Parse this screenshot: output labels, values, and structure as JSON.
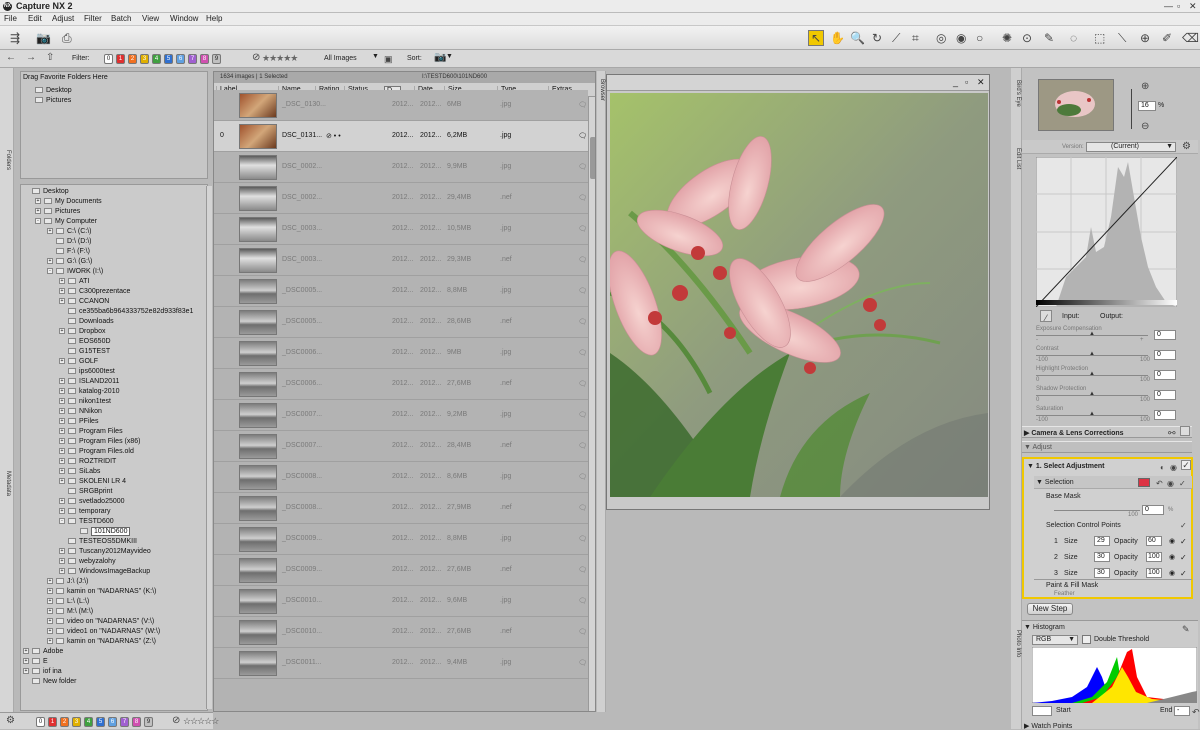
{
  "window": {
    "title": "Capture NX 2",
    "logo": "NX"
  },
  "menu": [
    "File",
    "Edit",
    "Adjust",
    "Filter",
    "Batch",
    "View",
    "Window",
    "Help"
  ],
  "toolbar2": {
    "filter_label": "Filter:",
    "filter_chips": [
      "0",
      "1",
      "2",
      "3",
      "4",
      "5",
      "6",
      "7",
      "8",
      "9"
    ],
    "filter_colors": [
      "#ffffff",
      "#e03030",
      "#f07020",
      "#e0b000",
      "#40a040",
      "#3070d0",
      "#60a0e0",
      "#a060d0",
      "#d050b0",
      "#c0c0c0"
    ],
    "show_dropdown": "All Images",
    "sort_label": "Sort:"
  },
  "sidebars": {
    "folders": "Folders",
    "metadata": "Metadata",
    "browser": "Browser",
    "birds_eye": "Bird's Eye",
    "edit_list": "Edit List",
    "photo_info": "Photo Info"
  },
  "favorites": {
    "header": "Drag Favorite Folders Here",
    "items": [
      "Desktop",
      "Pictures"
    ]
  },
  "tree": [
    {
      "label": "Desktop",
      "d": 0,
      "pm": "",
      "icon": true
    },
    {
      "label": "My Documents",
      "d": 1,
      "pm": "+",
      "icon": true
    },
    {
      "label": "Pictures",
      "d": 1,
      "pm": "+",
      "icon": true
    },
    {
      "label": "My Computer",
      "d": 1,
      "pm": "-",
      "icon": true
    },
    {
      "label": "C:\\ (C:\\)",
      "d": 2,
      "pm": "+",
      "icon": true
    },
    {
      "label": "D:\\ (D:\\)",
      "d": 2,
      "pm": "",
      "icon": true
    },
    {
      "label": "F:\\ (F:\\)",
      "d": 2,
      "pm": "",
      "icon": true
    },
    {
      "label": "G:\\ (G:\\)",
      "d": 2,
      "pm": "+",
      "icon": true
    },
    {
      "label": "IWORK (I:\\)",
      "d": 2,
      "pm": "-",
      "icon": true
    },
    {
      "label": "ATI",
      "d": 3,
      "pm": "+",
      "icon": true
    },
    {
      "label": "C300prezentace",
      "d": 3,
      "pm": "+",
      "icon": true
    },
    {
      "label": "CCANON",
      "d": 3,
      "pm": "+",
      "icon": true
    },
    {
      "label": "ce355ba6b964333752e82d933f83e1",
      "d": 3,
      "pm": "",
      "icon": true
    },
    {
      "label": "Downloads",
      "d": 3,
      "pm": "",
      "icon": true
    },
    {
      "label": "Dropbox",
      "d": 3,
      "pm": "+",
      "icon": true
    },
    {
      "label": "EOS650D",
      "d": 3,
      "pm": "",
      "icon": true
    },
    {
      "label": "G15TEST",
      "d": 3,
      "pm": "",
      "icon": true
    },
    {
      "label": "GOLF",
      "d": 3,
      "pm": "+",
      "icon": true
    },
    {
      "label": "ips6000test",
      "d": 3,
      "pm": "",
      "icon": true
    },
    {
      "label": "ISLAND2011",
      "d": 3,
      "pm": "+",
      "icon": true
    },
    {
      "label": "katalog-2010",
      "d": 3,
      "pm": "+",
      "icon": true
    },
    {
      "label": "nikon1test",
      "d": 3,
      "pm": "+",
      "icon": true
    },
    {
      "label": "NNikon",
      "d": 3,
      "pm": "+",
      "icon": true
    },
    {
      "label": "PFiles",
      "d": 3,
      "pm": "+",
      "icon": true
    },
    {
      "label": "Program Files",
      "d": 3,
      "pm": "+",
      "icon": true
    },
    {
      "label": "Program Files (x86)",
      "d": 3,
      "pm": "+",
      "icon": true
    },
    {
      "label": "Program Files.old",
      "d": 3,
      "pm": "+",
      "icon": true
    },
    {
      "label": "ROZTRIDIT",
      "d": 3,
      "pm": "+",
      "icon": true
    },
    {
      "label": "SiLabs",
      "d": 3,
      "pm": "+",
      "icon": true
    },
    {
      "label": "SKOLENI LR 4",
      "d": 3,
      "pm": "+",
      "icon": true
    },
    {
      "label": "SRGBprint",
      "d": 3,
      "pm": "",
      "icon": true
    },
    {
      "label": "svetlado25000",
      "d": 3,
      "pm": "+",
      "icon": true
    },
    {
      "label": "temporary",
      "d": 3,
      "pm": "+",
      "icon": true
    },
    {
      "label": "TESTD600",
      "d": 3,
      "pm": "-",
      "icon": true
    },
    {
      "label": "101ND600",
      "d": 4,
      "pm": "",
      "icon": true,
      "sel": true
    },
    {
      "label": "TESTEOS5DMKIII",
      "d": 3,
      "pm": "",
      "icon": true
    },
    {
      "label": "Tuscany2012Mayvideo",
      "d": 3,
      "pm": "+",
      "icon": true
    },
    {
      "label": "webyzalohy",
      "d": 3,
      "pm": "+",
      "icon": true
    },
    {
      "label": "WindowsImageBackup",
      "d": 3,
      "pm": "+",
      "icon": true
    },
    {
      "label": "J:\\ (J:\\)",
      "d": 2,
      "pm": "+",
      "icon": true
    },
    {
      "label": "kamin  on \"NADARNAS\" (K:\\)",
      "d": 2,
      "pm": "+",
      "icon": true
    },
    {
      "label": "L:\\ (L:\\)",
      "d": 2,
      "pm": "+",
      "icon": true
    },
    {
      "label": "M:\\ (M:\\)",
      "d": 2,
      "pm": "+",
      "icon": true
    },
    {
      "label": "video  on \"NADARNAS\" (V:\\)",
      "d": 2,
      "pm": "+",
      "icon": true
    },
    {
      "label": "video1  on \"NADARNAS\" (W:\\)",
      "d": 2,
      "pm": "+",
      "icon": true
    },
    {
      "label": "kamin  on \"NADARNAS\" (Z:\\)",
      "d": 2,
      "pm": "+",
      "icon": true
    },
    {
      "label": "Adobe",
      "d": 0,
      "pm": "+",
      "icon": true
    },
    {
      "label": "E",
      "d": 0,
      "pm": "+",
      "icon": true
    },
    {
      "label": "iof ina",
      "d": 0,
      "pm": "+",
      "icon": true
    },
    {
      "label": "New folder",
      "d": 0,
      "pm": "",
      "icon": true
    }
  ],
  "browser": {
    "status": "1634 images | 1 Selected",
    "path": "I:\\TESTD600\\101ND600",
    "columns": [
      "Label",
      "Name",
      "Rating",
      "Status",
      "D...",
      "Date...",
      "Size",
      "Type",
      "Extras"
    ],
    "rows": [
      {
        "label": "",
        "name": "_DSC_0130...",
        "date": "2012...",
        "date2": "2012...",
        "size": "6MB",
        "type": ".jpg",
        "kind": "warm"
      },
      {
        "label": "0",
        "name": "DSC_0131...",
        "date": "2012...",
        "date2": "2012...",
        "size": "6,2MB",
        "type": ".jpg",
        "kind": "warm",
        "sel": true
      },
      {
        "label": "",
        "name": "DSC_0002...",
        "date": "2012...",
        "date2": "2012...",
        "size": "9,9MB",
        "type": ".jpg",
        "kind": "gray"
      },
      {
        "label": "",
        "name": "DSC_0002...",
        "date": "2012...",
        "date2": "2012...",
        "size": "29,4MB",
        "type": ".nef",
        "kind": "gray"
      },
      {
        "label": "",
        "name": "DSC_0003...",
        "date": "2012...",
        "date2": "2012...",
        "size": "10,5MB",
        "type": ".jpg",
        "kind": "gray"
      },
      {
        "label": "",
        "name": "DSC_0003...",
        "date": "2012...",
        "date2": "2012...",
        "size": "29,3MB",
        "type": ".nef",
        "kind": "gray"
      },
      {
        "label": "",
        "name": "_DSC0005...",
        "date": "2012...",
        "date2": "2012...",
        "size": "8,8MB",
        "type": ".jpg",
        "kind": "land"
      },
      {
        "label": "",
        "name": "_DSC0005...",
        "date": "2012...",
        "date2": "2012...",
        "size": "28,6MB",
        "type": ".nef",
        "kind": "land"
      },
      {
        "label": "",
        "name": "_DSC0006...",
        "date": "2012...",
        "date2": "2012...",
        "size": "9MB",
        "type": ".jpg",
        "kind": "land"
      },
      {
        "label": "",
        "name": "_DSC0006...",
        "date": "2012...",
        "date2": "2012...",
        "size": "27,6MB",
        "type": ".nef",
        "kind": "land"
      },
      {
        "label": "",
        "name": "_DSC0007...",
        "date": "2012...",
        "date2": "2012...",
        "size": "9,2MB",
        "type": ".jpg",
        "kind": "land"
      },
      {
        "label": "",
        "name": "_DSC0007...",
        "date": "2012...",
        "date2": "2012...",
        "size": "28,4MB",
        "type": ".nef",
        "kind": "land"
      },
      {
        "label": "",
        "name": "_DSC0008...",
        "date": "2012...",
        "date2": "2012...",
        "size": "8,6MB",
        "type": ".jpg",
        "kind": "land"
      },
      {
        "label": "",
        "name": "_DSC0008...",
        "date": "2012...",
        "date2": "2012...",
        "size": "27,9MB",
        "type": ".nef",
        "kind": "land"
      },
      {
        "label": "",
        "name": "_DSC0009...",
        "date": "2012...",
        "date2": "2012...",
        "size": "8,8MB",
        "type": ".jpg",
        "kind": "land"
      },
      {
        "label": "",
        "name": "_DSC0009...",
        "date": "2012...",
        "date2": "2012...",
        "size": "27,6MB",
        "type": ".nef",
        "kind": "land"
      },
      {
        "label": "",
        "name": "_DSC0010...",
        "date": "2012...",
        "date2": "2012...",
        "size": "9,6MB",
        "type": ".jpg",
        "kind": "land"
      },
      {
        "label": "",
        "name": "_DSC0010...",
        "date": "2012...",
        "date2": "2012...",
        "size": "27,6MB",
        "type": ".nef",
        "kind": "land"
      },
      {
        "label": "",
        "name": "_DSC0011...",
        "date": "2012...",
        "date2": "2012...",
        "size": "9,4MB",
        "type": ".jpg",
        "kind": "land"
      }
    ]
  },
  "birdseye": {
    "zoom": "16",
    "unit": "%"
  },
  "editlist": {
    "version_label": "Version:",
    "version_value": "(Current)",
    "input_label": "Input:",
    "output_label": "Output:",
    "sliders": [
      {
        "label": "Exposure Compensation",
        "value": "0",
        "min": "-",
        "max": "+"
      },
      {
        "label": "Contrast",
        "value": "0",
        "min": "-100",
        "max": "100"
      },
      {
        "label": "Highlight Protection",
        "value": "0",
        "min": "0",
        "max": "100"
      },
      {
        "label": "Shadow Protection",
        "value": "0",
        "min": "0",
        "max": "100"
      },
      {
        "label": "Saturation",
        "value": "0",
        "min": "-100",
        "max": "100"
      }
    ],
    "camera_lens": "Camera & Lens Corrections",
    "adjust": "Adjust",
    "select_adjustment": "1. Select Adjustment",
    "selection": "Selection",
    "base_mask": "Base Mask",
    "base_mask_value": "0",
    "base_mask_unit": "%",
    "base_mask_max": "100",
    "control_points_label": "Selection Control Points",
    "control_points": [
      {
        "n": "1",
        "size": "29",
        "opacity": "60"
      },
      {
        "n": "2",
        "size": "30",
        "opacity": "100"
      },
      {
        "n": "3",
        "size": "30",
        "opacity": "100"
      }
    ],
    "size_label": "Size",
    "opacity_label": "Opacity",
    "paint_fill": "Paint & Fill Mask",
    "feather": "Feather",
    "new_step": "New Step"
  },
  "histogram": {
    "title": "Histogram",
    "channel": "RGB",
    "double_threshold": "Double Threshold",
    "start_label": "Start",
    "end_label": "End",
    "end_value": "-"
  },
  "watch_points": "Watch Points",
  "bottombar": {
    "chips": [
      "0",
      "1",
      "2",
      "3",
      "4",
      "5",
      "6",
      "7",
      "8",
      "9"
    ]
  }
}
